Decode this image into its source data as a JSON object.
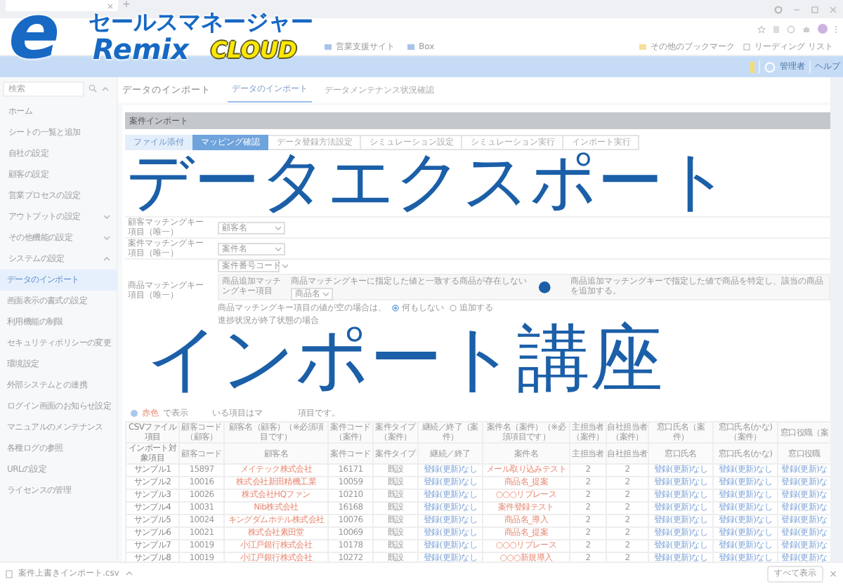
{
  "logo": {
    "mark": "e",
    "name": "セールスマネージャー",
    "product": "Remix",
    "edition": "CLOUD"
  },
  "title_overlay": {
    "line1": "データエクスポート",
    "separator": "・",
    "line2": "インポート講座"
  },
  "browser": {
    "new_tab": "+",
    "bookmarks_left": [
      "営業支援サイト",
      "Box"
    ],
    "bookmarks_right": [
      "その他のブックマーク",
      "リーディング リスト"
    ]
  },
  "app_header": {
    "user": "管理者",
    "help": "ヘルプ"
  },
  "sidebar": {
    "search": {
      "placeholder": "検索"
    },
    "items": [
      {
        "label": "ホーム",
        "selected": false
      },
      {
        "label": "シートの一覧と追加",
        "selected": false
      },
      {
        "label": "自社の設定",
        "selected": false
      },
      {
        "label": "顧客の設定",
        "selected": false
      },
      {
        "label": "営業プロセスの設定",
        "selected": false
      },
      {
        "label": "アウトプットの設定",
        "selected": false,
        "expanded": false
      },
      {
        "label": "その他機能の設定",
        "selected": false,
        "expanded": false
      },
      {
        "label": "システムの設定",
        "selected": false,
        "expanded": true,
        "children": [
          {
            "label": "データのインポート",
            "selected": true
          },
          {
            "label": "画面表示の書式の設定",
            "selected": false
          },
          {
            "label": "利用機能の制限",
            "selected": false
          },
          {
            "label": "セキュリティポリシーの変更",
            "selected": false
          },
          {
            "label": "環境設定",
            "selected": false
          },
          {
            "label": "外部システムとの連携",
            "selected": false
          },
          {
            "label": "ログイン画面のお知らせ設定",
            "selected": false
          },
          {
            "label": "マニュアルのメンテナンス",
            "selected": false
          },
          {
            "label": "各種ログの参照",
            "selected": false
          },
          {
            "label": "URLの設定",
            "selected": false
          },
          {
            "label": "ライセンスの管理",
            "selected": false
          }
        ]
      }
    ]
  },
  "page": {
    "title": "データのインポート",
    "tabs": [
      {
        "label": "データのインポート",
        "selected": true
      },
      {
        "label": "データメンテナンス状況確認",
        "selected": false
      }
    ]
  },
  "section": "案件インポート",
  "steps": [
    {
      "label": "ファイル添付",
      "done": true,
      "selected": false
    },
    {
      "label": "マッピング確認",
      "done": false,
      "selected": true
    },
    {
      "label": "データ登録方法設定",
      "done": false,
      "selected": false
    },
    {
      "label": "シミュレーション設定",
      "done": false,
      "selected": false
    },
    {
      "label": "シミュレーション実行",
      "done": false,
      "selected": false
    },
    {
      "label": "インポート実行",
      "done": false,
      "selected": false
    }
  ],
  "form": {
    "customer_key": {
      "label": "顧客マッチングキー項目（唯一）",
      "value": "顧客名"
    },
    "deal_key": {
      "label": "案件マッチングキー項目（唯一）",
      "value": "案件名"
    },
    "product_key": {
      "label": "商品マッチングキー項目（唯一）",
      "code_select": "案件番号コード",
      "add_key_label": "商品追加マッチングキー項目",
      "add_key_hint": "商品マッチングキーに指定した値と一致する商品が存在しない",
      "add_key_value": "商品名",
      "add_key_description": "商品追加マッチングキーで指定した値で商品を特定し、該当の商品を追加する。",
      "empty_hint": "商品マッチングキー項目の値が空の場合は、",
      "options": [
        {
          "label": "何もしない",
          "selected": true
        },
        {
          "label": "追加する",
          "selected": false
        }
      ],
      "closed_hint": "進捗状況が終了状態の場合"
    }
  },
  "note": {
    "highlight": "赤色",
    "fragments": [
      "で表示",
      "いる項目はマ",
      "項目です。"
    ]
  },
  "table": {
    "columns": [
      {
        "csv": "CSVファイル項目",
        "target": "インポート対象項目",
        "kind": "label"
      },
      {
        "csv": "顧客コード（顧客）",
        "target": "顧客コード",
        "kind": "plain"
      },
      {
        "csv": "顧客名（顧客）（※必須項目です）",
        "target": "顧客名",
        "kind": "required"
      },
      {
        "csv": "案件コード（案件）",
        "target": "案件コード",
        "kind": "plain"
      },
      {
        "csv": "案件タイプ（案件）",
        "target": "案件タイプ",
        "kind": "plain"
      },
      {
        "csv": "継続／終了（案件）",
        "target": "継続／終了",
        "kind": "link"
      },
      {
        "csv": "案件名（案件）（※必須項目です）",
        "target": "案件名",
        "kind": "required"
      },
      {
        "csv": "主担当者（案件）",
        "target": "主担当者",
        "kind": "plain"
      },
      {
        "csv": "自社担当者（案件）",
        "target": "自社担当者",
        "kind": "plain"
      },
      {
        "csv": "窓口氏名（案件）",
        "target": "窓口氏名",
        "kind": "link"
      },
      {
        "csv": "窓口氏名(かな)（案件）",
        "target": "窓口氏名(かな)",
        "kind": "link"
      },
      {
        "csv": "窓口役職（案",
        "target": "窓口役職",
        "kind": "link"
      }
    ],
    "rows": [
      [
        "サンプル1",
        "15897",
        "メイテック株式会社",
        "16171",
        "既設",
        "登録(更新)なし",
        "メール取り込みテスト",
        "2",
        "2",
        "登録(更新)なし",
        "登録(更新)なし",
        "登録(更新)な"
      ],
      [
        "サンプル2",
        "10016",
        "株式会社新田精機工業",
        "10059",
        "既設",
        "登録(更新)なし",
        "商品名_提案",
        "2",
        "2",
        "登録(更新)なし",
        "登録(更新)なし",
        "登録(更新)な"
      ],
      [
        "サンプル3",
        "10026",
        "株式会社HQファン",
        "10210",
        "既設",
        "登録(更新)なし",
        "○○○リプレース",
        "2",
        "2",
        "登録(更新)なし",
        "登録(更新)なし",
        "登録(更新)な"
      ],
      [
        "サンプル4",
        "10031",
        "Nib株式会社",
        "16168",
        "既設",
        "登録(更新)なし",
        "案件登録テスト",
        "2",
        "2",
        "登録(更新)なし",
        "登録(更新)なし",
        "登録(更新)な"
      ],
      [
        "サンプル5",
        "10024",
        "キングダムホテル株式会社",
        "10076",
        "既設",
        "登録(更新)なし",
        "商品名_導入",
        "2",
        "2",
        "登録(更新)なし",
        "登録(更新)なし",
        "登録(更新)な"
      ],
      [
        "サンプル6",
        "10021",
        "株式会社素田堂",
        "10069",
        "既設",
        "登録(更新)なし",
        "商品名_提案",
        "2",
        "2",
        "登録(更新)なし",
        "登録(更新)なし",
        "登録(更新)な"
      ],
      [
        "サンプル7",
        "10019",
        "小江戸銀行株式会社",
        "10178",
        "既設",
        "登録(更新)なし",
        "○○○リプレース",
        "2",
        "2",
        "登録(更新)なし",
        "登録(更新)なし",
        "登録(更新)な"
      ],
      [
        "サンプル8",
        "10019",
        "小江戸銀行株式会社",
        "10272",
        "既設",
        "登録(更新)なし",
        "○○○新規導入",
        "2",
        "2",
        "登録(更新)なし",
        "登録(更新)なし",
        "登録(更新)な"
      ]
    ]
  },
  "download_bar": {
    "file": "案件上書きインポート.csv",
    "show_all": "すべて表示",
    "close": "×"
  }
}
